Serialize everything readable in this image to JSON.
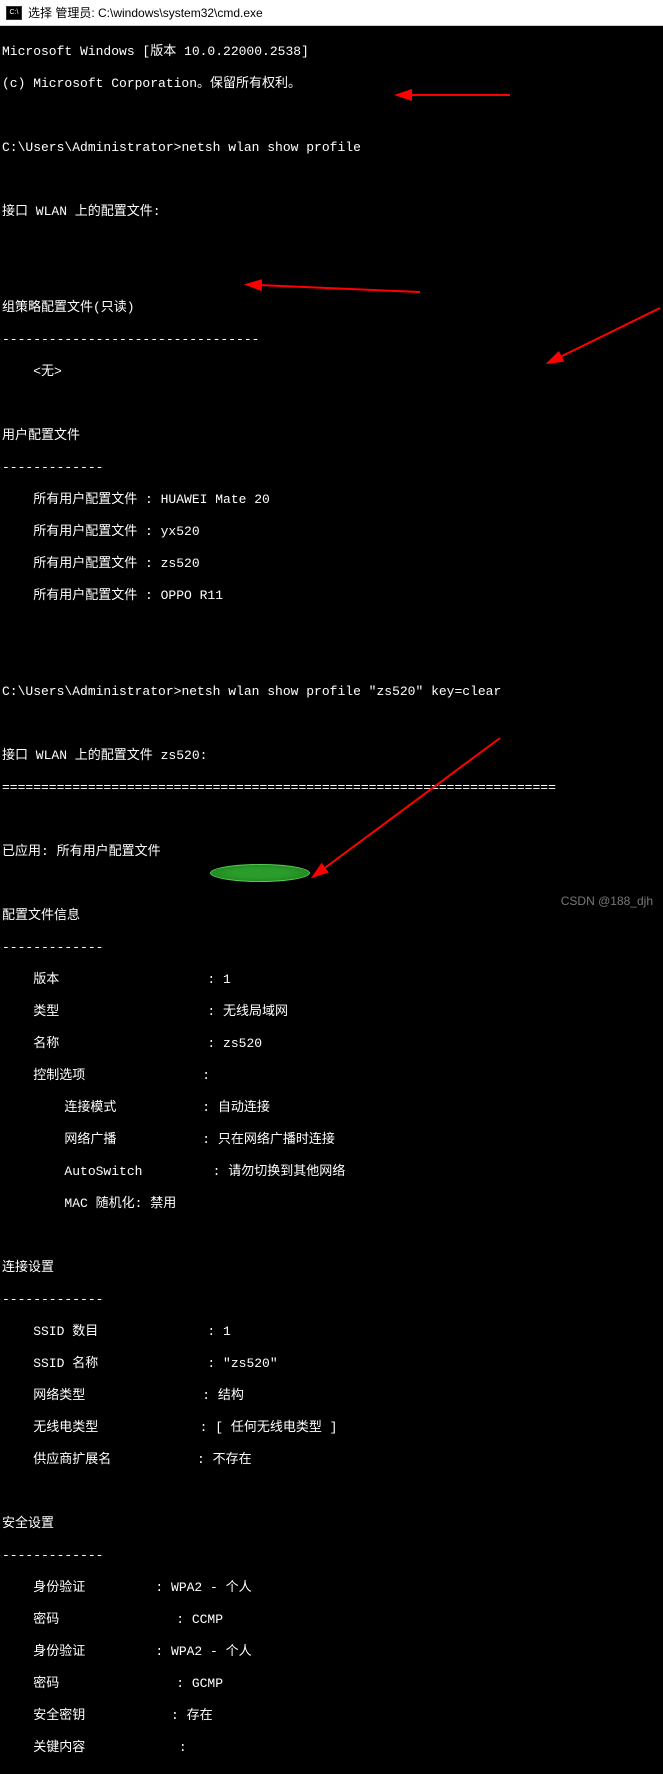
{
  "titlebar": {
    "text": "选择 管理员: C:\\windows\\system32\\cmd.exe"
  },
  "winver": "Microsoft Windows [版本 10.0.22000.2538]",
  "copyright": "(c) Microsoft Corporation。保留所有权利。",
  "prompt_path": "C:\\Users\\Administrator>",
  "cmd1": "netsh wlan show profile",
  "hdr_interface_profiles": "接口 WLAN 上的配置文件:",
  "hdr_group_policy": "组策略配置文件(只读)",
  "dash_long": "---------------------------------",
  "none_text": "    <无>",
  "hdr_user_profiles": "用户配置文件",
  "dash_short": "-------------",
  "profile_label": "    所有用户配置文件 : ",
  "profiles": {
    "p1": "HUAWEI Mate 20",
    "p2": "yx520",
    "p3": "zs520",
    "p4": "OPPO R11"
  },
  "cmd2": "netsh wlan show profile \"zs520\" key=clear",
  "hdr_interface_profile2": "接口 WLAN 上的配置文件 zs520:",
  "eqline": "=======================================================================",
  "applied_line": "已应用: 所有用户配置文件",
  "sec_profile_info": "配置文件信息",
  "info": {
    "version_k": "    版本                   : ",
    "version_v": "1",
    "type_k": "    类型                   : ",
    "type_v": "无线局域网",
    "name_k": "    名称                   : ",
    "name_v": "zs520",
    "ctrl_k": "    控制选项               :",
    "connmode_k": "        连接模式           : ",
    "connmode_v": "自动连接",
    "broadcast_k": "        网络广播           : ",
    "broadcast_v": "只在网络广播时连接",
    "autoswitch_k": "        AutoSwitch         : ",
    "autoswitch_v": "请勿切换到其他网络",
    "macrand_k": "        MAC 随机化: 禁用"
  },
  "sec_conn": "连接设置",
  "conn": {
    "ssidcount_k": "    SSID 数目              : ",
    "ssidcount_v": "1",
    "ssidname_k": "    SSID 名称              : ",
    "ssidname_v": "\"zs520\"",
    "nettype_k": "    网络类型               : ",
    "nettype_v": "结构",
    "radiotype_k": "    无线电类型             : ",
    "radiotype_v": "[ 任何无线电类型 ]",
    "vendor_k": "    供应商扩展名           : ",
    "vendor_v": "不存在"
  },
  "sec_security": "安全设置",
  "sec": {
    "auth_k": "    身份验证         : ",
    "auth_v": "WPA2 - 个人",
    "cipher_k": "    密码               : ",
    "cipher_v": "CCMP",
    "auth2_k": "    身份验证         : ",
    "auth2_v": "WPA2 - 个人",
    "cipher2_k": "    密码               : ",
    "cipher2_v": "GCMP",
    "seckey_k": "    安全密钥           : ",
    "seckey_v": "存在",
    "keycontent_k": "    关键内容            : "
  },
  "watermark": "CSDN @188_djh"
}
